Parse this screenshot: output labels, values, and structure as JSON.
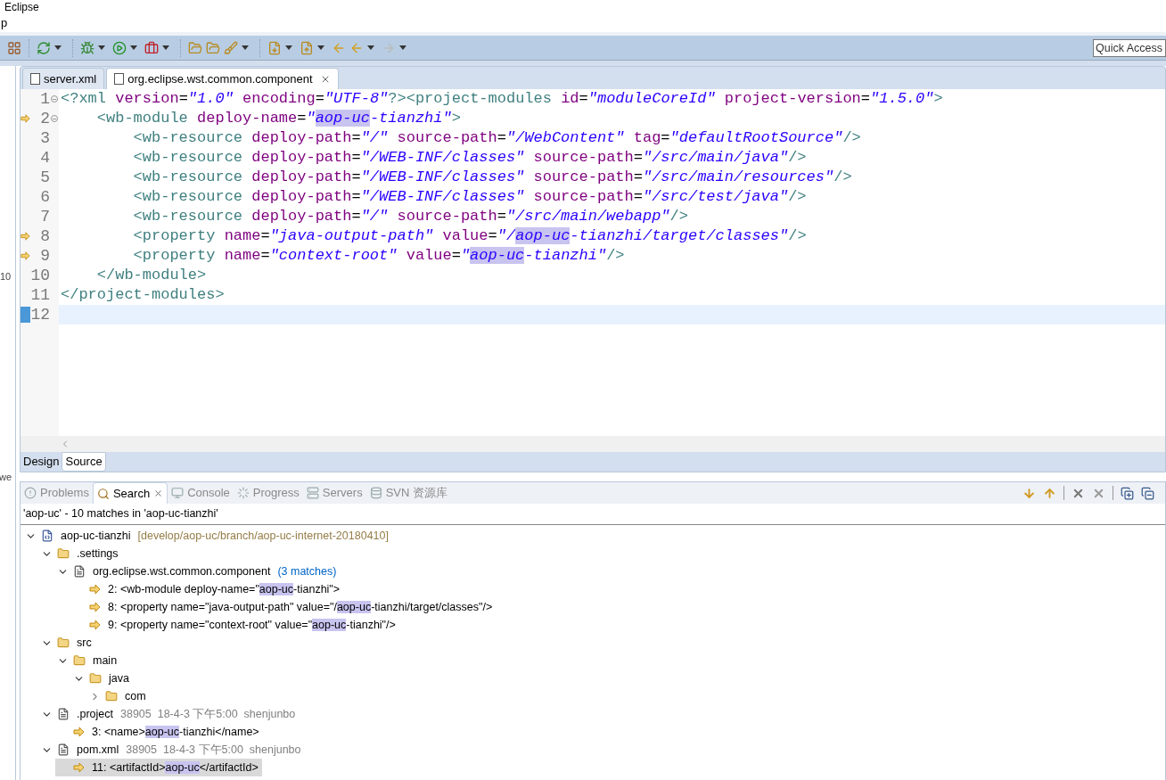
{
  "window": {
    "title": "Eclipse"
  },
  "menu_fragment": "p",
  "left_fragments": [
    "10",
    "we"
  ],
  "quick_access": {
    "placeholder": "Quick Access"
  },
  "editor_tabs": [
    {
      "label": "server.xml",
      "selected": false,
      "closable": false
    },
    {
      "label": "org.eclipse.wst.common.component",
      "selected": true,
      "closable": true
    }
  ],
  "code_lines": [
    {
      "number": "1",
      "foldable": true,
      "marked": false,
      "current": false,
      "tokens": [
        {
          "kind": "tag",
          "text": "<?xml"
        },
        {
          "kind": "attr",
          "text": " version"
        },
        {
          "kind": "plain",
          "text": "="
        },
        {
          "kind": "value",
          "text": "\"1.0\""
        },
        {
          "kind": "attr",
          "text": " encoding"
        },
        {
          "kind": "plain",
          "text": "="
        },
        {
          "kind": "value",
          "text": "\"UTF-8\""
        },
        {
          "kind": "tag",
          "text": "?><project-modules"
        },
        {
          "kind": "attr",
          "text": " id"
        },
        {
          "kind": "plain",
          "text": "="
        },
        {
          "kind": "value",
          "text": "\"moduleCoreId\""
        },
        {
          "kind": "attr",
          "text": " project-version"
        },
        {
          "kind": "plain",
          "text": "="
        },
        {
          "kind": "value",
          "text": "\"1.5.0\""
        },
        {
          "kind": "tag",
          "text": ">"
        }
      ]
    },
    {
      "number": "2",
      "foldable": true,
      "marked": true,
      "current": false,
      "tokens": [
        {
          "kind": "tag",
          "text": "    <wb-module"
        },
        {
          "kind": "attr",
          "text": " deploy-name"
        },
        {
          "kind": "plain",
          "text": "="
        },
        {
          "kind": "value",
          "text": "\""
        },
        {
          "kind": "match",
          "text": "aop-uc"
        },
        {
          "kind": "value",
          "text": "-tianzhi\""
        },
        {
          "kind": "tag",
          "text": ">"
        }
      ]
    },
    {
      "number": "3",
      "foldable": false,
      "marked": false,
      "current": false,
      "tokens": [
        {
          "kind": "tag",
          "text": "        <wb-resource"
        },
        {
          "kind": "attr",
          "text": " deploy-path"
        },
        {
          "kind": "plain",
          "text": "="
        },
        {
          "kind": "value",
          "text": "\"/\""
        },
        {
          "kind": "attr",
          "text": " source-path"
        },
        {
          "kind": "plain",
          "text": "="
        },
        {
          "kind": "value",
          "text": "\"/WebContent\""
        },
        {
          "kind": "attr",
          "text": " tag"
        },
        {
          "kind": "plain",
          "text": "="
        },
        {
          "kind": "value",
          "text": "\"defaultRootSource\""
        },
        {
          "kind": "tag",
          "text": "/>"
        }
      ]
    },
    {
      "number": "4",
      "foldable": false,
      "marked": false,
      "current": false,
      "tokens": [
        {
          "kind": "tag",
          "text": "        <wb-resource"
        },
        {
          "kind": "attr",
          "text": " deploy-path"
        },
        {
          "kind": "plain",
          "text": "="
        },
        {
          "kind": "value",
          "text": "\"/WEB-INF/classes\""
        },
        {
          "kind": "attr",
          "text": " source-path"
        },
        {
          "kind": "plain",
          "text": "="
        },
        {
          "kind": "value",
          "text": "\"/src/main/java\""
        },
        {
          "kind": "tag",
          "text": "/>"
        }
      ]
    },
    {
      "number": "5",
      "foldable": false,
      "marked": false,
      "current": false,
      "tokens": [
        {
          "kind": "tag",
          "text": "        <wb-resource"
        },
        {
          "kind": "attr",
          "text": " deploy-path"
        },
        {
          "kind": "plain",
          "text": "="
        },
        {
          "kind": "value",
          "text": "\"/WEB-INF/classes\""
        },
        {
          "kind": "attr",
          "text": " source-path"
        },
        {
          "kind": "plain",
          "text": "="
        },
        {
          "kind": "value",
          "text": "\"/src/main/resources\""
        },
        {
          "kind": "tag",
          "text": "/>"
        }
      ]
    },
    {
      "number": "6",
      "foldable": false,
      "marked": false,
      "current": false,
      "tokens": [
        {
          "kind": "tag",
          "text": "        <wb-resource"
        },
        {
          "kind": "attr",
          "text": " deploy-path"
        },
        {
          "kind": "plain",
          "text": "="
        },
        {
          "kind": "value",
          "text": "\"/WEB-INF/classes\""
        },
        {
          "kind": "attr",
          "text": " source-path"
        },
        {
          "kind": "plain",
          "text": "="
        },
        {
          "kind": "value",
          "text": "\"/src/test/java\""
        },
        {
          "kind": "tag",
          "text": "/>"
        }
      ]
    },
    {
      "number": "7",
      "foldable": false,
      "marked": false,
      "current": false,
      "tokens": [
        {
          "kind": "tag",
          "text": "        <wb-resource"
        },
        {
          "kind": "attr",
          "text": " deploy-path"
        },
        {
          "kind": "plain",
          "text": "="
        },
        {
          "kind": "value",
          "text": "\"/\""
        },
        {
          "kind": "attr",
          "text": " source-path"
        },
        {
          "kind": "plain",
          "text": "="
        },
        {
          "kind": "value",
          "text": "\"/src/main/webapp\""
        },
        {
          "kind": "tag",
          "text": "/>"
        }
      ]
    },
    {
      "number": "8",
      "foldable": false,
      "marked": true,
      "current": false,
      "tokens": [
        {
          "kind": "tag",
          "text": "        <property"
        },
        {
          "kind": "attr",
          "text": " name"
        },
        {
          "kind": "plain",
          "text": "="
        },
        {
          "kind": "value",
          "text": "\"java-output-path\""
        },
        {
          "kind": "attr",
          "text": " value"
        },
        {
          "kind": "plain",
          "text": "="
        },
        {
          "kind": "value",
          "text": "\"/"
        },
        {
          "kind": "match",
          "text": "aop-uc"
        },
        {
          "kind": "value",
          "text": "-tianzhi/target/classes\""
        },
        {
          "kind": "tag",
          "text": "/>"
        }
      ]
    },
    {
      "number": "9",
      "foldable": false,
      "marked": true,
      "current": false,
      "tokens": [
        {
          "kind": "tag",
          "text": "        <property"
        },
        {
          "kind": "attr",
          "text": " name"
        },
        {
          "kind": "plain",
          "text": "="
        },
        {
          "kind": "value",
          "text": "\"context-root\""
        },
        {
          "kind": "attr",
          "text": " value"
        },
        {
          "kind": "plain",
          "text": "="
        },
        {
          "kind": "value",
          "text": "\""
        },
        {
          "kind": "match",
          "text": "aop-uc"
        },
        {
          "kind": "value",
          "text": "-tianzhi\""
        },
        {
          "kind": "tag",
          "text": "/>"
        }
      ]
    },
    {
      "number": "10",
      "foldable": false,
      "marked": false,
      "current": false,
      "tokens": [
        {
          "kind": "tag",
          "text": "    </wb-module>"
        }
      ]
    },
    {
      "number": "11",
      "foldable": false,
      "marked": false,
      "current": false,
      "tokens": [
        {
          "kind": "tag",
          "text": "</project-modules>"
        }
      ]
    },
    {
      "number": "12",
      "foldable": false,
      "marked": false,
      "current": true
    }
  ],
  "page_tabs": [
    {
      "label": "Design",
      "selected": false
    },
    {
      "label": "Source",
      "selected": true
    }
  ],
  "view_tabs": [
    {
      "kind": "problems",
      "label": "Problems",
      "selected": false
    },
    {
      "kind": "search",
      "label": "Search",
      "selected": true
    },
    {
      "kind": "console",
      "label": "Console",
      "selected": false
    },
    {
      "kind": "progress",
      "label": "Progress",
      "selected": false
    },
    {
      "kind": "servers",
      "label": "Servers",
      "selected": false
    },
    {
      "kind": "svn",
      "label": "SVN 资源库",
      "selected": false
    }
  ],
  "search_summary": "'aop-uc' - 10 matches in 'aop-uc-tianzhi'",
  "results": [
    {
      "kind": "project",
      "label": "aop-uc-tianzhi",
      "detail": "[develop/aop-uc/branch/aop-uc-internet-20180410]",
      "expanded": true,
      "selected": false,
      "children": [
        {
          "kind": "folder",
          "label": ".settings",
          "expanded": true,
          "selected": false,
          "children": [
            {
              "kind": "file",
              "label": "org.eclipse.wst.common.component",
              "count": "(3 matches)",
              "expanded": true,
              "selected": false,
              "children": [
                {
                  "kind": "match",
                  "line": "2:",
                  "selected": false,
                  "parts": [
                    {
                      "kind": "plain",
                      "text": "<wb-module deploy-name=\""
                    },
                    {
                      "kind": "match",
                      "text": "aop-uc"
                    },
                    {
                      "kind": "plain",
                      "text": "-tianzhi\">"
                    }
                  ]
                },
                {
                  "kind": "match",
                  "line": "8:",
                  "selected": false,
                  "parts": [
                    {
                      "kind": "plain",
                      "text": "<property name=\"java-output-path\" value=\"/"
                    },
                    {
                      "kind": "match",
                      "text": "aop-uc"
                    },
                    {
                      "kind": "plain",
                      "text": "-tianzhi/target/classes\"/>"
                    }
                  ]
                },
                {
                  "kind": "match",
                  "line": "9:",
                  "selected": false,
                  "parts": [
                    {
                      "kind": "plain",
                      "text": "<property name=\"context-root\" value=\""
                    },
                    {
                      "kind": "match",
                      "text": "aop-uc"
                    },
                    {
                      "kind": "plain",
                      "text": "-tianzhi\"/>"
                    }
                  ]
                }
              ]
            }
          ]
        },
        {
          "kind": "folder",
          "label": "src",
          "expanded": true,
          "selected": false,
          "children": [
            {
              "kind": "folder",
              "label": "main",
              "expanded": true,
              "selected": false,
              "children": [
                {
                  "kind": "folder",
                  "label": "java",
                  "expanded": true,
                  "selected": false,
                  "children": [
                    {
                      "kind": "folder",
                      "label": "com",
                      "expanded": false,
                      "selected": false
                    }
                  ]
                }
              ]
            }
          ]
        },
        {
          "kind": "file",
          "label": ".project",
          "detail": "38905  18-4-3 下午5:00  shenjunbo",
          "expanded": true,
          "selected": false,
          "children": [
            {
              "kind": "match",
              "line": "3:",
              "selected": false,
              "parts": [
                {
                  "kind": "plain",
                  "text": "<name>"
                },
                {
                  "kind": "match",
                  "text": "aop-uc"
                },
                {
                  "kind": "plain",
                  "text": "-tianzhi</name>"
                }
              ]
            }
          ]
        },
        {
          "kind": "file",
          "label": "pom.xml",
          "detail": "38905  18-4-3 下午5:00  shenjunbo",
          "expanded": true,
          "selected": false,
          "children": [
            {
              "kind": "match",
              "line": "11:",
              "selected": true,
              "parts": [
                {
                  "kind": "plain",
                  "text": "<artifactId>"
                },
                {
                  "kind": "match",
                  "text": "aop-uc"
                },
                {
                  "kind": "plain",
                  "text": "</artifactId>"
                }
              ]
            }
          ]
        }
      ]
    }
  ]
}
